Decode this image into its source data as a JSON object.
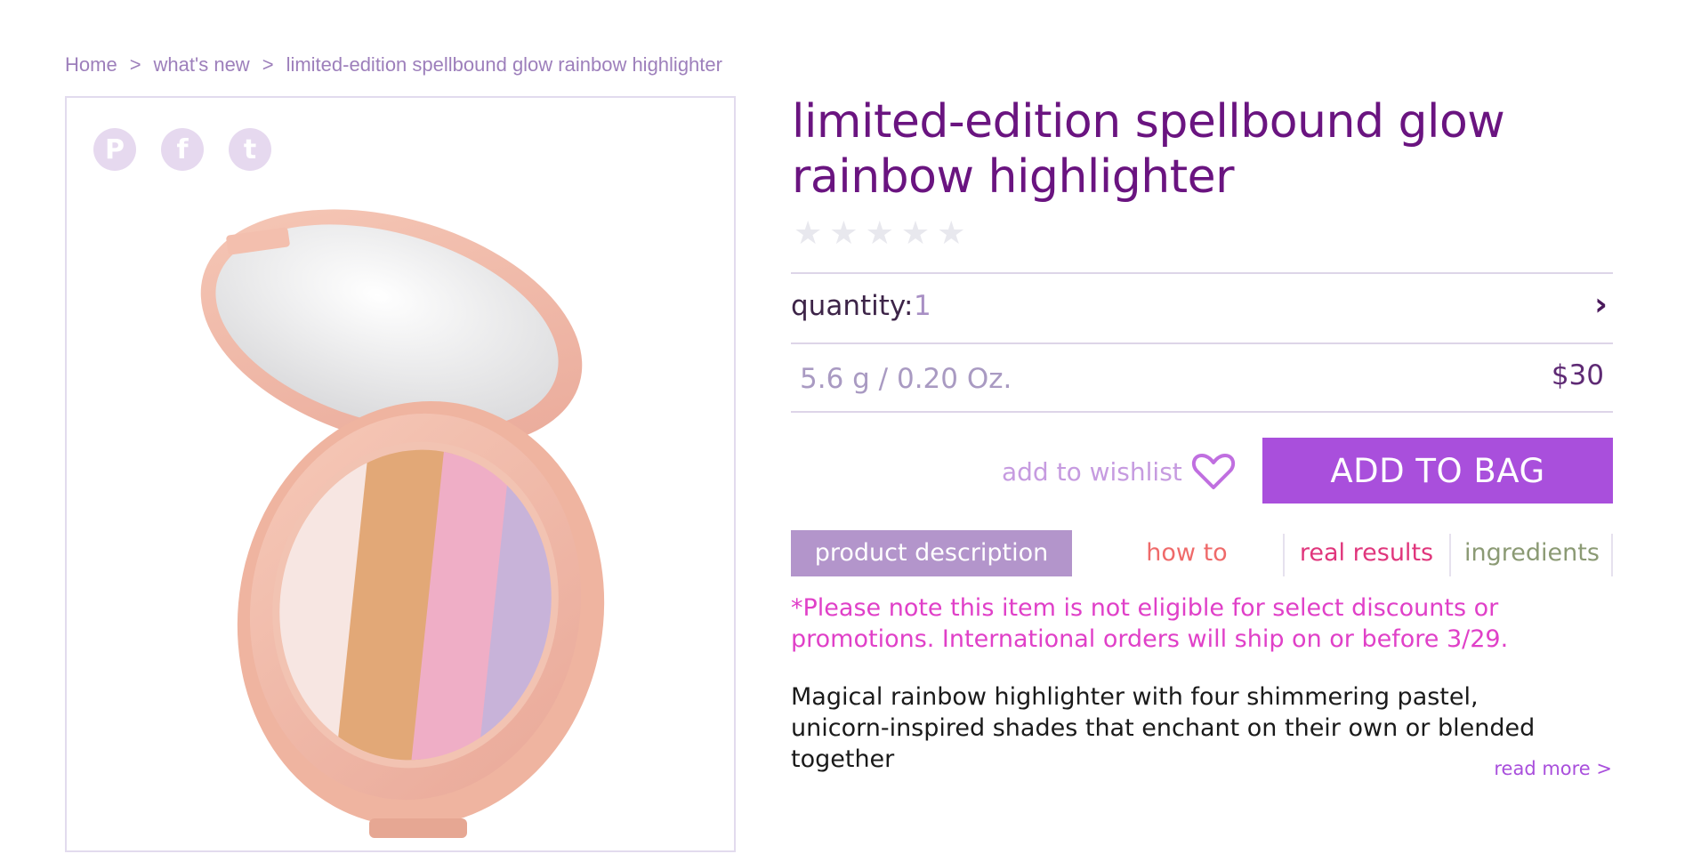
{
  "breadcrumb": {
    "home": "Home",
    "separator": ">",
    "section": "what's new",
    "current": "limited-edition spellbound glow rainbow highlighter"
  },
  "share": {
    "icons": [
      "pinterest-icon",
      "facebook-icon",
      "twitter-icon"
    ],
    "pinterest_glyph": "P",
    "facebook_glyph": "f",
    "twitter_glyph": "t"
  },
  "product": {
    "title": "limited-edition spellbound glow rainbow highlighter",
    "rating": 0,
    "rating_max": 5,
    "quantity_label": "quantity:",
    "quantity_value": "1",
    "size": "5.6 g / 0.20 Oz.",
    "price": "$30"
  },
  "actions": {
    "wishlist_label": "add to wishlist",
    "add_to_bag_label": "ADD TO BAG"
  },
  "tabs": [
    {
      "label": "product description",
      "color": "#ffffff"
    },
    {
      "label": "how to",
      "color": "#ef6a6a"
    },
    {
      "label": "real results",
      "color": "#e0367c"
    },
    {
      "label": "ingredients",
      "color": "#8b9a74"
    }
  ],
  "content": {
    "note": "*Please note this item is not eligible for select discounts or promotions. International orders will ship on or before 3/29.",
    "description": "Magical rainbow highlighter with four shimmering pastel, unicorn-inspired shades that enchant on their own or blended together",
    "read_more": "read more >"
  },
  "colors": {
    "brand_purple": "#6a1480",
    "button_purple": "#a94fdc",
    "active_tab": "#b395cb",
    "note_pink": "#e040c8"
  }
}
